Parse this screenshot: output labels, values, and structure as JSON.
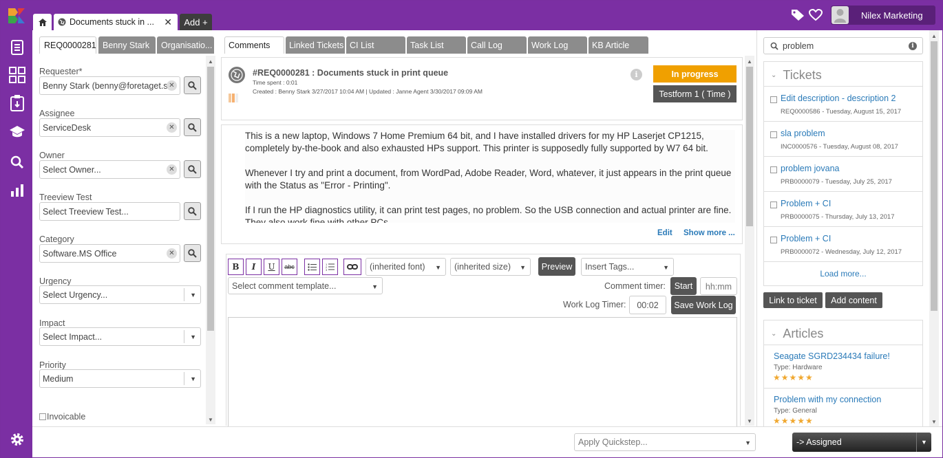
{
  "header": {
    "doc_tab": "Documents stuck in ...",
    "add_tab": "Add +",
    "profile_name": "Nilex Marketing"
  },
  "left_tabs": [
    "REQ0000281",
    "Benny Stark",
    "Organisatio..."
  ],
  "fields": {
    "requester_label": "Requester*",
    "requester_value": "Benny Stark (benny@foretaget.se)",
    "assignee_label": "Assignee",
    "assignee_value": "ServiceDesk",
    "owner_label": "Owner",
    "owner_placeholder": "Select Owner...",
    "treeview_label": "Treeview Test",
    "treeview_placeholder": "Select Treeview Test...",
    "category_label": "Category",
    "category_value": "Software.MS Office",
    "urgency_label": "Urgency",
    "urgency_placeholder": "Select Urgency...",
    "impact_label": "Impact",
    "impact_placeholder": "Select Impact...",
    "priority_label": "Priority",
    "priority_value": "Medium",
    "invoicable_label": "Invoicable"
  },
  "main_tabs": [
    "Comments",
    "Linked Tickets",
    "CI List",
    "Task List",
    "Call Log",
    "Work Log",
    "KB Article"
  ],
  "ticket": {
    "id_title": "#REQ0000281 :  Documents stuck in print queue",
    "time_spent": "Time spent : 0:01",
    "meta": "Created : Benny Stark 3/27/2017 10:04 AM | Updated : Janne Agent 3/30/2017 09:09 AM",
    "status": "In progress",
    "form": "Testform 1 ( Time )",
    "status_color": "#f0a000"
  },
  "description": {
    "p1": "This is a new laptop, Windows 7 Home Premium 64 bit, and I have installed drivers for my HP Laserjet CP1215, completely by-the-book and also exhausted HPs support. This printer is supposedly fully supported by W7 64 bit.",
    "p2": "Whenever I try and print a document, from WordPad, Adobe Reader, Word, whatever, it just appears in the print queue with the Status as \"Error - Printing\".",
    "p3": "If I run the HP diagnostics utility, it can print test pages, no problem. So the USB connection and actual printer are fine.",
    "p4": "They also work fine with other PCs",
    "edit": "Edit",
    "show_more": "Show more ..."
  },
  "editor": {
    "font_select": "(inherited font)",
    "size_select": "(inherited size)",
    "preview": "Preview",
    "insert_tags": "Insert Tags...",
    "template_placeholder": "Select comment template...",
    "comment_timer_label": "Comment timer:",
    "start": "Start",
    "time_placeholder": "hh:mm",
    "work_log_timer_label": "Work Log Timer:",
    "work_log_time": "00:02",
    "save_work_log": "Save Work Log"
  },
  "right": {
    "search_value": "problem",
    "tickets_title": "Tickets",
    "tickets": [
      {
        "title": "Edit description - description 2",
        "sub": "REQ0000586 - Tuesday, August 15, 2017"
      },
      {
        "title": "sla problem",
        "sub": "INC0000576 - Tuesday, August 08, 2017"
      },
      {
        "title": "problem jovana",
        "sub": "PRB0000079 - Tuesday, July 25, 2017"
      },
      {
        "title": "Problem + CI",
        "sub": "PRB0000075 - Thursday, July 13, 2017"
      },
      {
        "title": "Problem + CI",
        "sub": "PRB0000072 - Wednesday, July 12, 2017"
      }
    ],
    "load_more": "Load more...",
    "link_to_ticket": "Link to ticket",
    "add_content": "Add content",
    "articles_title": "Articles",
    "articles": [
      {
        "title": "Seagate SGRD234434 failure!",
        "type": "Type: Hardware",
        "stars": "★★★★★"
      },
      {
        "title": "Problem with my connection",
        "type": "Type: General",
        "stars": "★★★★★"
      }
    ]
  },
  "footer": {
    "quickstep_placeholder": "Apply Quickstep...",
    "assigned": "-> Assigned"
  }
}
